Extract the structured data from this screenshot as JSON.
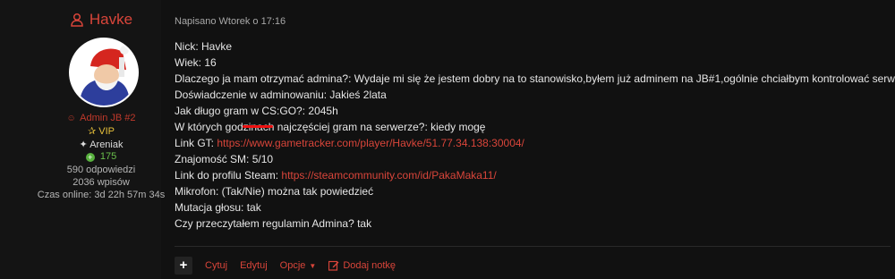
{
  "author": {
    "name": "Havke",
    "rank": "Admin JB #2",
    "vip": "VIP",
    "club": "Areniak",
    "reputation": "175",
    "replies": "590 odpowiedzi",
    "posts": "2036 wpisów",
    "online_time": "Czas online: 3d 22h 57m 34s"
  },
  "post": {
    "posted": "Napisano Wtorek o 17:16",
    "lines": [
      {
        "text": "Nick: Havke",
        "link": ""
      },
      {
        "text": "Wiek: 16",
        "link": ""
      },
      {
        "text": "Dlaczego ja mam otrzymać admina?: Wydaje mi się że jestem dobry na to stanowisko,byłem już adminem na JB#1,ogólnie chciałbym kontrolować serwer",
        "link": ""
      },
      {
        "text": "Doświadczenie w adminowaniu: Jakieś 2lata",
        "link": ""
      },
      {
        "text": "Jak długo gram w CS:GO?: 2045h",
        "link": ""
      },
      {
        "text": "W których godzinach najczęściej gram na serwerze?: kiedy mogę",
        "link": ""
      },
      {
        "text": "Link GT: ",
        "link": "https://www.gametracker.com/player/Havke/51.77.34.138:30004/"
      },
      {
        "text": "Znajomość SM: 5/10",
        "link": ""
      },
      {
        "text": "Link do profilu Steam: ",
        "link": "https://steamcommunity.com/id/PakaMaka11/"
      },
      {
        "text": "Mikrofon: (Tak/Nie) można tak powiedzieć",
        "link": ""
      },
      {
        "text": "Mutacja głosu: tak",
        "link": ""
      },
      {
        "text": "Czy przeczytałem regulamin Admina? tak",
        "link": ""
      }
    ]
  },
  "actions": {
    "plus": "+",
    "quote": "Cytuj",
    "edit": "Edytuj",
    "options": "Opcje",
    "add_note": "Dodaj notkę"
  },
  "colors": {
    "accent": "#d9453a",
    "vip": "#e8c13b",
    "reputation": "#58b13e",
    "background": "#111111"
  },
  "icons": {
    "author": "user-icon",
    "rank": "user-small-icon",
    "vip": "star-icon",
    "club": "bird-icon",
    "reputation": "plus-circle-icon",
    "options": "caret-down-icon",
    "note": "edit-note-icon"
  }
}
